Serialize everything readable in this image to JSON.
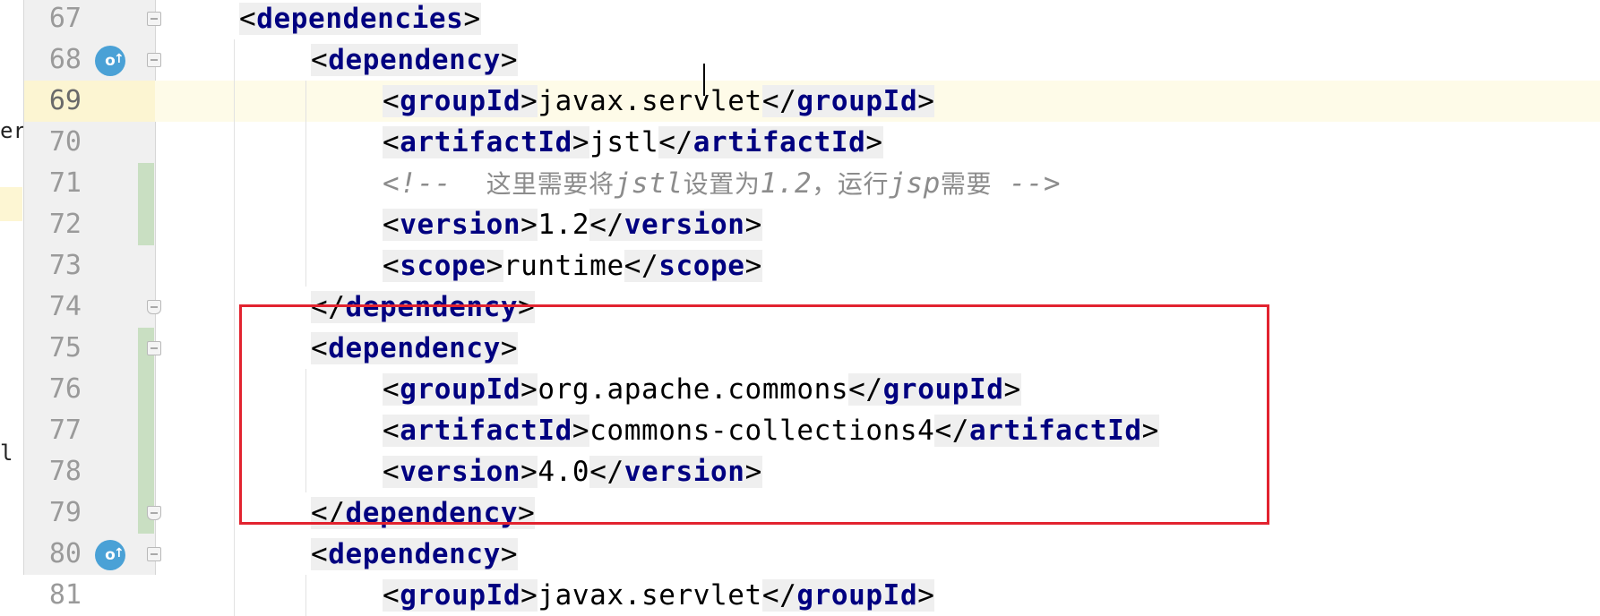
{
  "editor": {
    "sidebar_fragments": [
      "erl",
      "l"
    ],
    "lines": [
      {
        "n": "67",
        "indent": 0,
        "kind": "tag",
        "tag": "dependencies",
        "closing": false
      },
      {
        "n": "68",
        "indent": 1,
        "kind": "tag",
        "tag": "dependency",
        "closing": false,
        "gutter_icon": "maven-override-icon"
      },
      {
        "n": "69",
        "indent": 2,
        "kind": "elem",
        "tag": "groupId",
        "text": "javax.servlet",
        "current": true
      },
      {
        "n": "70",
        "indent": 2,
        "kind": "elem",
        "tag": "artifactId",
        "text": "jstl"
      },
      {
        "n": "71",
        "indent": 2,
        "kind": "comment",
        "text": "<!--  这里需要将jstl设置为1.2，运行jsp需要 -->"
      },
      {
        "n": "72",
        "indent": 2,
        "kind": "elem",
        "tag": "version",
        "text": "1.2"
      },
      {
        "n": "73",
        "indent": 2,
        "kind": "elem",
        "tag": "scope",
        "text": "runtime"
      },
      {
        "n": "74",
        "indent": 1,
        "kind": "tag",
        "tag": "dependency",
        "closing": true
      },
      {
        "n": "75",
        "indent": 1,
        "kind": "tag",
        "tag": "dependency",
        "closing": false
      },
      {
        "n": "76",
        "indent": 2,
        "kind": "elem",
        "tag": "groupId",
        "text": "org.apache.commons"
      },
      {
        "n": "77",
        "indent": 2,
        "kind": "elem",
        "tag": "artifactId",
        "text": "commons-collections4"
      },
      {
        "n": "78",
        "indent": 2,
        "kind": "elem",
        "tag": "version",
        "text": "4.0"
      },
      {
        "n": "79",
        "indent": 1,
        "kind": "tag",
        "tag": "dependency",
        "closing": true
      },
      {
        "n": "80",
        "indent": 1,
        "kind": "tag",
        "tag": "dependency",
        "closing": false,
        "gutter_icon": "maven-override-icon"
      },
      {
        "n": "81",
        "indent": 2,
        "kind": "elem",
        "tag": "groupId",
        "text": "javax.servlet"
      }
    ],
    "highlight_color": "#e2232f",
    "tag_color": "#000080",
    "comment_color": "#8c8c8c"
  }
}
